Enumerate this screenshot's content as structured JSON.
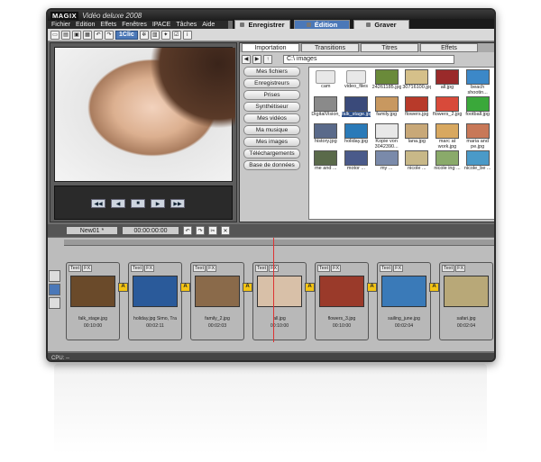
{
  "app": {
    "logo": "MAGIX",
    "title": "Vidéo deluxe 2008"
  },
  "menu": [
    "Fichier",
    "Edition",
    "Effets",
    "Fenêtres",
    "IPACE",
    "Tâches",
    "Aide"
  ],
  "modes": [
    {
      "label": "Enregistrer",
      "active": false
    },
    {
      "label": "Édition",
      "active": true
    },
    {
      "label": "Graver",
      "active": false
    }
  ],
  "toolbar": {
    "oneclic": "1Clic"
  },
  "pool": {
    "tabs": [
      "Importation",
      "Transitions",
      "Titres",
      "Effets"
    ],
    "path": "C:\\ images",
    "nav": [
      "Mes fichiers",
      "Enregistreurs",
      "Prises",
      "Synthétiseur",
      "Mes vidéos",
      "Ma musique",
      "Mes images",
      "Téléchargements",
      "Base de données"
    ],
    "files": [
      {
        "name": "cam",
        "folder": true
      },
      {
        "name": "video_files",
        "folder": true
      },
      {
        "name": "24261185.jpg",
        "color": "#6a8a3a"
      },
      {
        "name": "30716100.jpg",
        "color": "#d5c08a"
      },
      {
        "name": "all.jpg",
        "color": "#9a2a2a"
      },
      {
        "name": "beach shootin...",
        "color": "#3c88c8"
      },
      {
        "name": "DigitalVision_M82...",
        "color": "#8a8a8a"
      },
      {
        "name": "falk_stage.jpg",
        "color": "#3a4a7a",
        "selected": true
      },
      {
        "name": "family.jpg",
        "color": "#c89860"
      },
      {
        "name": "flowers.jpg",
        "color": "#b83a2a"
      },
      {
        "name": "flowers_2.jpg",
        "color": "#d84a3a"
      },
      {
        "name": "football.jpg",
        "color": "#3aa83a"
      },
      {
        "name": "history.jpg",
        "color": "#5a6a8a"
      },
      {
        "name": "holiday.jpg",
        "color": "#2a7ab8"
      },
      {
        "name": "Kopie von 3042390...",
        "color": "#e8e8e8"
      },
      {
        "name": "lana.jpg",
        "color": "#c8a878"
      },
      {
        "name": "marc at work.jpg",
        "color": "#d8a860"
      },
      {
        "name": "maria and pe.jpg",
        "color": "#c87858"
      },
      {
        "name": "me and ...",
        "color": "#5a6a4a"
      },
      {
        "name": "motor ...",
        "color": "#4a5a8a"
      },
      {
        "name": "my ...",
        "color": "#7a8aaa"
      },
      {
        "name": "nicole ...",
        "color": "#c8b888"
      },
      {
        "name": "nicole ing ...",
        "color": "#8aaa6a"
      },
      {
        "name": "nicole_be ...",
        "color": "#4a9ac8"
      }
    ]
  },
  "timeline": {
    "project": "New01 *",
    "timecode": "00:00:00:00",
    "clips": [
      {
        "name": "falk_stage.jpg",
        "time": "00:10:00",
        "color": "#6a4a2a"
      },
      {
        "name": "holiday.jpg Simo, Tra",
        "time": "00:02:11",
        "color": "#2a5a9a"
      },
      {
        "name": "family_2.jpg",
        "time": "00:02:03",
        "color": "#8a6a4a"
      },
      {
        "name": "all.jpg",
        "time": "00:10:00",
        "color": "#d8c0a8"
      },
      {
        "name": "flowers_3.jpg",
        "time": "00:10:00",
        "color": "#9a3a2a"
      },
      {
        "name": "sailing_june.jpg",
        "time": "00:02:04",
        "color": "#3a7ab8"
      },
      {
        "name": "safari.jpg",
        "time": "00:02:04",
        "color": "#b8a878"
      }
    ]
  },
  "status": {
    "cpu": "CPU:  --"
  }
}
